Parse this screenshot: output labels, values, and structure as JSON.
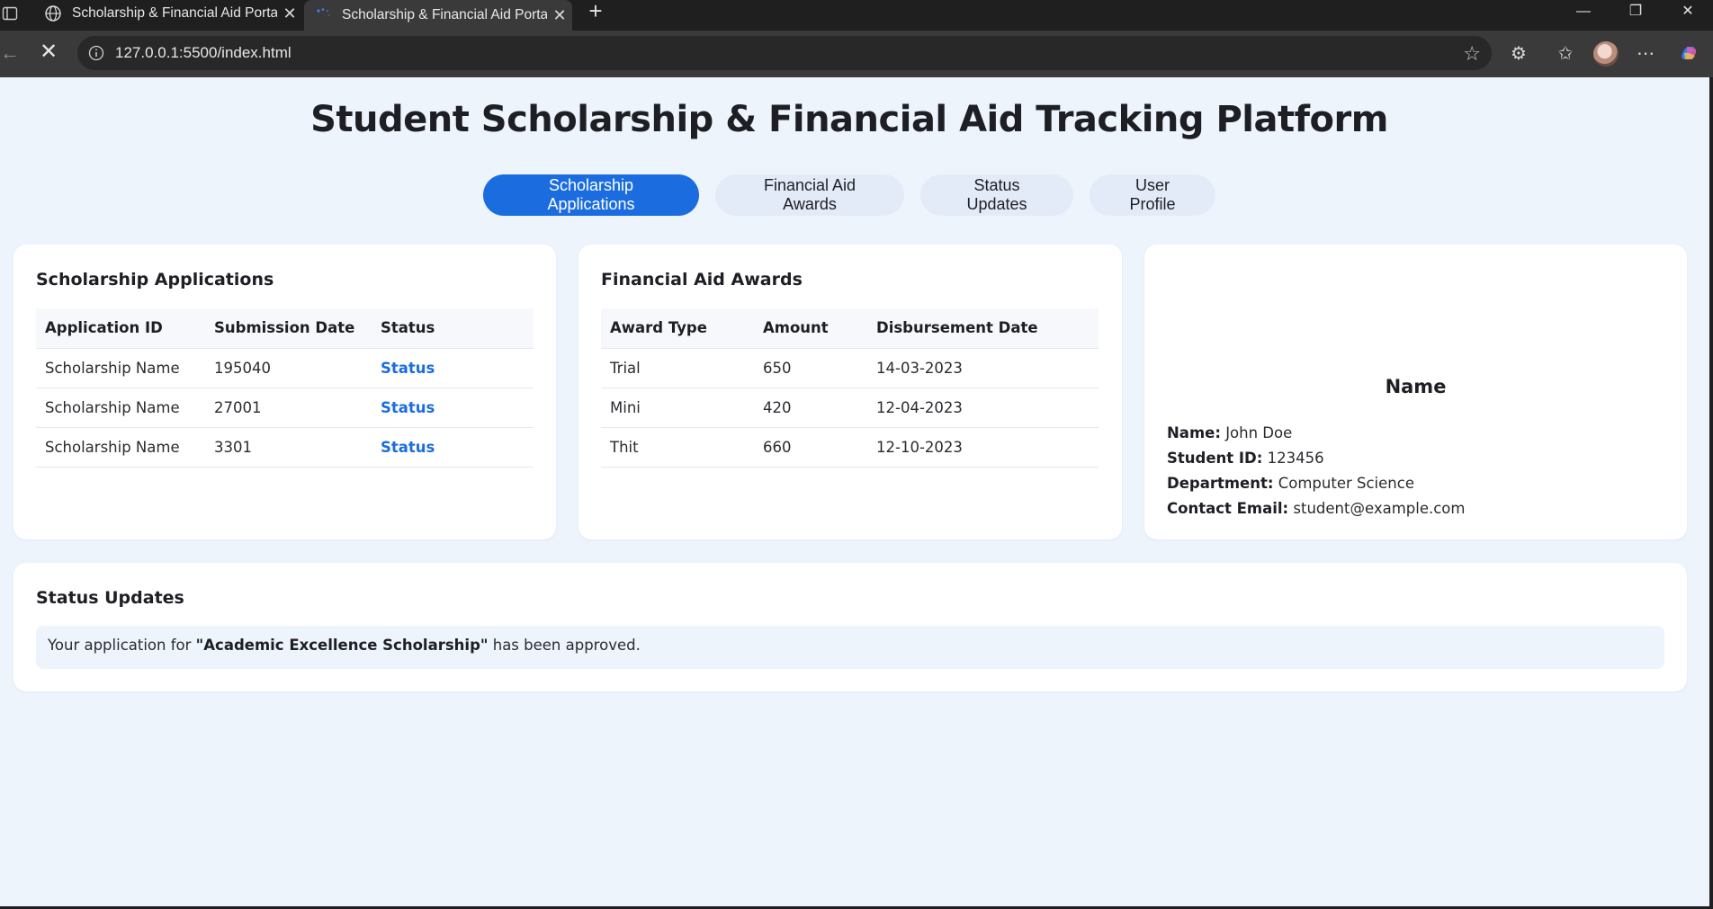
{
  "browser": {
    "tabs": [
      {
        "title": "Scholarship & Financial Aid Portal",
        "active": false
      },
      {
        "title": "Scholarship & Financial Aid Portal",
        "active": true
      }
    ],
    "url": "127.0.0.1:5500/index.html",
    "icons": [
      "sidebar-toggle-icon",
      "globe-icon",
      "loading-spinner-icon",
      "close-icon",
      "plus-icon",
      "minimize-icon",
      "restore-icon",
      "back-arrow-icon",
      "stop-icon",
      "info-icon",
      "star-icon",
      "extensions-icon",
      "favorites-icon",
      "more-icon",
      "copilot-icon"
    ]
  },
  "page": {
    "title": "Student Scholarship & Financial Aid Tracking Platform",
    "nav": [
      {
        "label": "Scholarship Applications",
        "active": true
      },
      {
        "label": "Financial Aid Awards",
        "active": false
      },
      {
        "label": "Status Updates",
        "active": false
      },
      {
        "label": "User Profile",
        "active": false
      }
    ],
    "accent_color": "#1b6ddf"
  },
  "applications": {
    "heading": "Scholarship Applications",
    "columns": [
      "Application ID",
      "Submission Date",
      "Status"
    ],
    "rows": [
      {
        "name": "Scholarship Name",
        "date": "195040",
        "status": "Status"
      },
      {
        "name": "Scholarship Name",
        "date": "27001",
        "status": "Status"
      },
      {
        "name": "Scholarship Name",
        "date": "3301",
        "status": "Status"
      }
    ]
  },
  "awards": {
    "heading": "Financial Aid Awards",
    "columns": [
      "Award Type",
      "Amount",
      "Disbursement Date"
    ],
    "rows": [
      {
        "type": "Trial",
        "amount": "650",
        "date": "14-03-2023"
      },
      {
        "type": "Mini",
        "amount": "420",
        "date": "12-04-2023"
      },
      {
        "type": "Thit",
        "amount": "660",
        "date": "12-10-2023"
      }
    ]
  },
  "profile": {
    "heading": "Name",
    "fields": [
      {
        "label": "Name:",
        "value": "John Doe"
      },
      {
        "label": "Student ID:",
        "value": "123456"
      },
      {
        "label": "Department:",
        "value": "Computer Science"
      },
      {
        "label": "Contact Email:",
        "value": "student@example.com"
      }
    ]
  },
  "status_updates": {
    "heading": "Status Updates",
    "message_prefix": "Your application for",
    "message_highlight": "\"Academic Excellence Scholarship\"",
    "message_suffix": "has been approved."
  }
}
